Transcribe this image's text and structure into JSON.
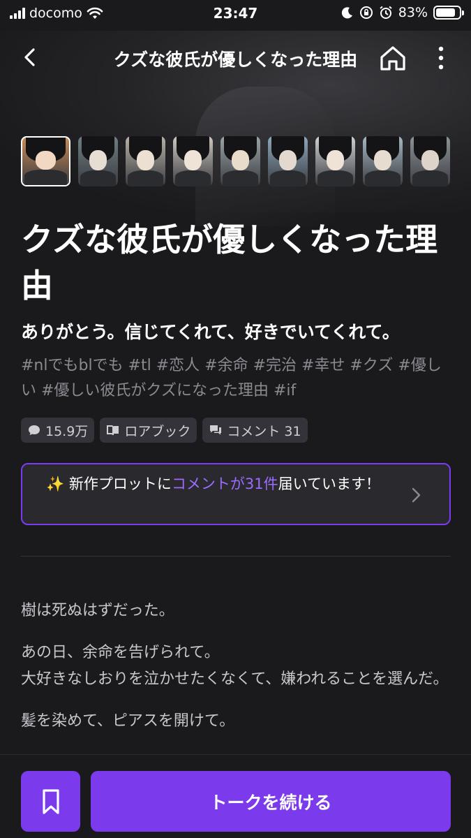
{
  "status": {
    "carrier": "docomo",
    "time": "23:47",
    "battery": "83%",
    "battery_level": 0.83
  },
  "header": {
    "title": "クズな彼氏が優しくなった理由"
  },
  "thumbnails": [
    {
      "skin": "#f0d8c2",
      "bg": "#c98a56"
    },
    {
      "skin": "#e6ddd3",
      "bg": "#6f7f84"
    },
    {
      "skin": "#ece0d2",
      "bg": "#b9b2a7"
    },
    {
      "skin": "#eee3d6",
      "bg": "#cfc8bf"
    },
    {
      "skin": "#e9dccb",
      "bg": "#9aa5a8"
    },
    {
      "skin": "#e4d9ce",
      "bg": "#8ea9bd"
    },
    {
      "skin": "#efe3d7",
      "bg": "#cfd4d6"
    },
    {
      "skin": "#e6dccf",
      "bg": "#a7b8c3"
    },
    {
      "skin": "#ddd3c9",
      "bg": "#8e9497"
    }
  ],
  "story": {
    "title": "クズな彼氏が優しくなった理由",
    "subtitle": "ありがとう。信じてくれて、好きでいてくれて。",
    "tags": "#nlでもblでも #tl #恋人 #余命 #完治 #幸せ #クズ #優しい #優しい彼氏がクズになった理由 #if",
    "talks": "15.9万",
    "lorebook": "ロアブック",
    "comments": "コメント 31"
  },
  "notice": {
    "icon": "✨",
    "prefix": " 新作プロットに",
    "highlight": "コメントが31件",
    "suffix": "届いています！"
  },
  "body": {
    "p1": "樹は死ぬはずだった。",
    "p2a": "あの日、余命を告げられて。",
    "p2b": "大好きなしおりを泣かせたくなくて、嫌われることを選んだ。",
    "p3": "髪を染めて、ピアスを開けて。"
  },
  "actions": {
    "continue_label": "トークを続ける"
  },
  "colors": {
    "accent": "#7c3aed",
    "highlight": "#9b6cff"
  }
}
